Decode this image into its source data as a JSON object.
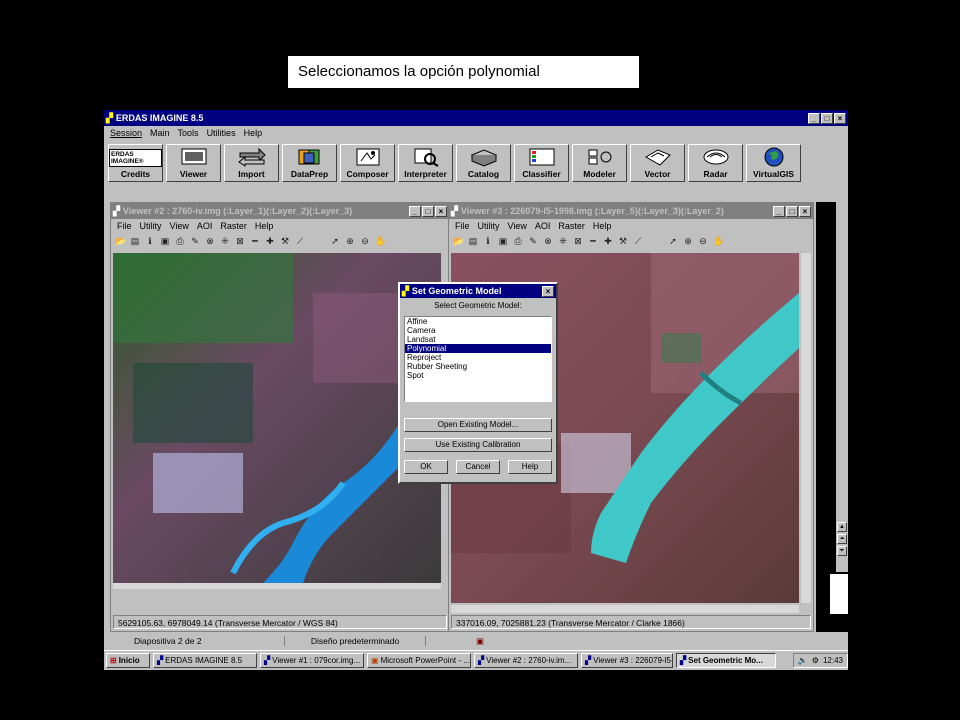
{
  "caption": "Seleccionamos la opción polynomial",
  "main_window": {
    "title": "ERDAS IMAGINE 8.5",
    "menu": [
      "Session",
      "Main",
      "Tools",
      "Utilities",
      "Help"
    ],
    "tools": [
      "Credits",
      "Viewer",
      "Import",
      "DataPrep",
      "Composer",
      "Interpreter",
      "Catalog",
      "Classifier",
      "Modeler",
      "Vector",
      "Radar",
      "VirtualGIS"
    ],
    "logo_text": "ERDAS IMAGINE®"
  },
  "viewer2": {
    "title": "Viewer #2 : 2760-iv.img (:Layer_1)(:Layer_2)(:Layer_3)",
    "menu": [
      "File",
      "Utility",
      "View",
      "AOI",
      "Raster",
      "Help"
    ],
    "status": "5629105.63, 6978049.14  (Transverse Mercator / WGS 84)"
  },
  "viewer3": {
    "title": "Viewer #3 : 226079-l5-1998.img (:Layer_5)(:Layer_3)(:Layer_2)",
    "menu": [
      "File",
      "Utility",
      "View",
      "AOI",
      "Raster",
      "Help"
    ],
    "status": "337016.09, 7025881.23  (Transverse Mercator / Clarke 1866)"
  },
  "dialog": {
    "title": "Set Geometric Model",
    "label": "Select Geometric Model:",
    "options": [
      "Affine",
      "Camera",
      "Landsat",
      "Polynomial",
      "Reproject",
      "Rubber Sheeting",
      "Spot"
    ],
    "selected_index": 3,
    "open_model": "Open Existing Model...",
    "use_calibration": "Use Existing Calibration",
    "ok": "OK",
    "cancel": "Cancel",
    "help": "Help"
  },
  "ppt_status": {
    "slide": "Diapositiva 2 de 2",
    "design": "Diseño predeterminado"
  },
  "taskbar": {
    "start": "Inicio",
    "tasks": [
      "ERDAS IMAGINE 8.5",
      "Viewer #1 : 079cor.img...",
      "Microsoft PowerPoint - ...",
      "Viewer #2 : 2760-iv.im...",
      "Viewer #3 : 226079-l5-...",
      "Set Geometric Mo..."
    ],
    "active_index": 5,
    "clock": "12:43"
  },
  "colors": {
    "titlebar_active": "#000080",
    "window_bg": "#c0c0c0",
    "selection": "#000080"
  }
}
